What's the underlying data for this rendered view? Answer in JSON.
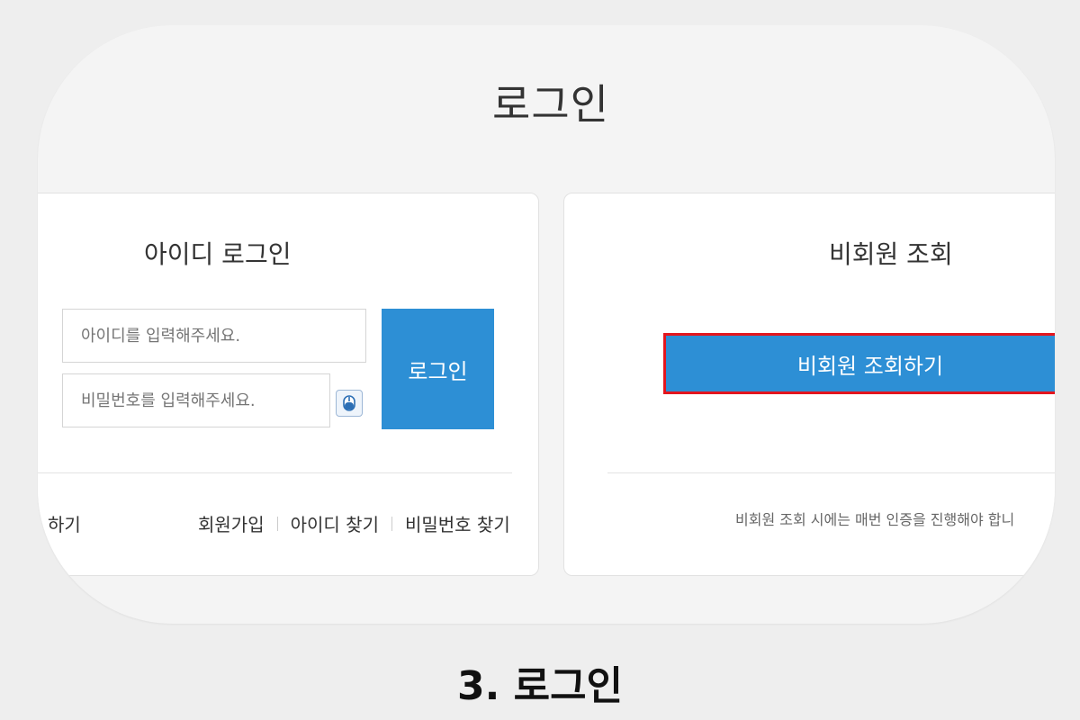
{
  "page": {
    "title": "로그인"
  },
  "id_login": {
    "title": "아이디 로그인",
    "id_placeholder": "아이디를 입력해주세요.",
    "pw_placeholder": "비밀번호를 입력해주세요.",
    "login_label": "로그인",
    "links": {
      "partial": "하기",
      "signup": "회원가입",
      "find_id": "아이디 찾기",
      "find_pw": "비밀번호 찾기"
    }
  },
  "guest": {
    "title": "비회원 조회",
    "button_label": "비회원 조회하기",
    "notice": "비회원 조회 시에는 매번 인증을 진행해야 합니"
  },
  "caption": "3. 로그인",
  "colors": {
    "accent": "#2d8fd5",
    "highlight": "#e3161e",
    "background": "#eeeeee",
    "card": "#ffffff"
  },
  "icons": {
    "pw_toggle": "mouse-icon"
  }
}
